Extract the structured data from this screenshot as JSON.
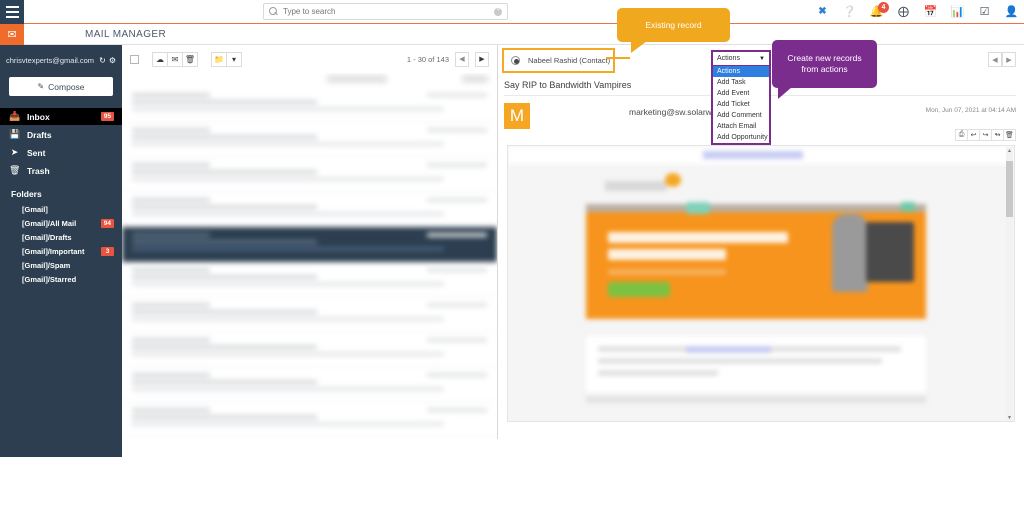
{
  "topbar": {
    "menu_icon": "hamburger-menu-icon",
    "search": {
      "placeholder": "Type to search",
      "value": "",
      "icon": "search-icon",
      "clear_icon": "clear-circle-icon"
    },
    "icons": [
      {
        "name": "xero-icon",
        "glyph": "X",
        "badge": ""
      },
      {
        "name": "help-icon",
        "glyph": "?",
        "badge": ""
      },
      {
        "name": "notifications-bell-icon",
        "glyph": "✉",
        "badge": "4"
      },
      {
        "name": "add-circle-icon",
        "glyph": "⊕",
        "badge": ""
      },
      {
        "name": "calendar-icon",
        "glyph": "▦",
        "badge": ""
      },
      {
        "name": "reports-chart-icon",
        "glyph": "▐",
        "badge": ""
      },
      {
        "name": "tasks-checkbox-icon",
        "glyph": "☑",
        "badge": ""
      },
      {
        "name": "user-profile-icon",
        "glyph": "♟",
        "badge": ""
      }
    ]
  },
  "module": {
    "icon": "envelope-icon",
    "title": "MAIL MANAGER"
  },
  "sidebar": {
    "account_email": "chrisvtexperts@gmail.com",
    "refresh_icon": "refresh-icon",
    "settings_icon": "gear-icon",
    "compose_label": "Compose",
    "compose_icon": "compose-pencil-icon",
    "nav": [
      {
        "label": "Inbox",
        "icon": "inbox-icon",
        "count": "95",
        "active": true
      },
      {
        "label": "Drafts",
        "icon": "drafts-icon",
        "count": "",
        "active": false
      },
      {
        "label": "Sent",
        "icon": "sent-paper-plane-icon",
        "count": "",
        "active": false
      },
      {
        "label": "Trash",
        "icon": "trash-icon",
        "count": "",
        "active": false
      }
    ],
    "folders_title": "Folders",
    "folders": [
      {
        "label": "[Gmail]",
        "count": ""
      },
      {
        "label": "[Gmail]/All Mail",
        "count": "94"
      },
      {
        "label": "[Gmail]/Drafts",
        "count": ""
      },
      {
        "label": "[Gmail]/Important",
        "count": "3"
      },
      {
        "label": "[Gmail]/Spam",
        "count": ""
      },
      {
        "label": "[Gmail]/Starred",
        "count": ""
      }
    ]
  },
  "list": {
    "select_all_checkbox": "",
    "toolbar": [
      {
        "name": "archive-button",
        "glyph": "☁"
      },
      {
        "name": "mark-read-button",
        "glyph": "✉"
      },
      {
        "name": "delete-button",
        "glyph": "Ὕ1"
      },
      {
        "name": "move-folder-button",
        "glyph": "▰"
      },
      {
        "name": "folder-dropdown-button",
        "glyph": "▼"
      }
    ],
    "pagination": "1 - 30 of 143",
    "prev_label": "◀",
    "next_label": "▶",
    "rows_blurred_note": ""
  },
  "reader": {
    "record": {
      "label": "Nabeel Rashid  (Contact)",
      "selected": true
    },
    "subject": "Say RIP to Bandwidth Vampires",
    "avatar_letter": "M",
    "sender": "marketing@sw.solarwinds.com",
    "timestamp": "Mon, Jun 07, 2021 at 04:14 AM",
    "message_actions": [
      {
        "name": "print-icon",
        "glyph": "⎙"
      },
      {
        "name": "reply-icon",
        "glyph": "↰"
      },
      {
        "name": "reply-all-icon",
        "glyph": "↰"
      },
      {
        "name": "forward-icon",
        "glyph": "↱"
      },
      {
        "name": "delete-icon",
        "glyph": "Ὕ1"
      }
    ],
    "prev_message_label": "◀",
    "next_message_label": "▶"
  },
  "actions_dropdown": {
    "selected": "Actions",
    "caret": "▼",
    "options": [
      {
        "label": "Actions",
        "highlighted": true
      },
      {
        "label": "Add Task",
        "highlighted": false
      },
      {
        "label": "Add Event",
        "highlighted": false
      },
      {
        "label": "Add Ticket",
        "highlighted": false
      },
      {
        "label": "Add Comment",
        "highlighted": false
      },
      {
        "label": "Attach Email",
        "highlighted": false
      },
      {
        "label": "Add Opportunity",
        "highlighted": false
      }
    ]
  },
  "callouts": {
    "existing_record": "Existing record",
    "create_records": "Create new records from actions"
  },
  "colors": {
    "brand_orange": "#ef6c2d",
    "sidebar_navy": "#2c3e50",
    "badge_red": "#e8543f",
    "callout_orange": "#f0a81e",
    "callout_purple": "#7b2d8e",
    "highlight_blue": "#2f7fe0",
    "avatar_orange": "#f5a623"
  }
}
